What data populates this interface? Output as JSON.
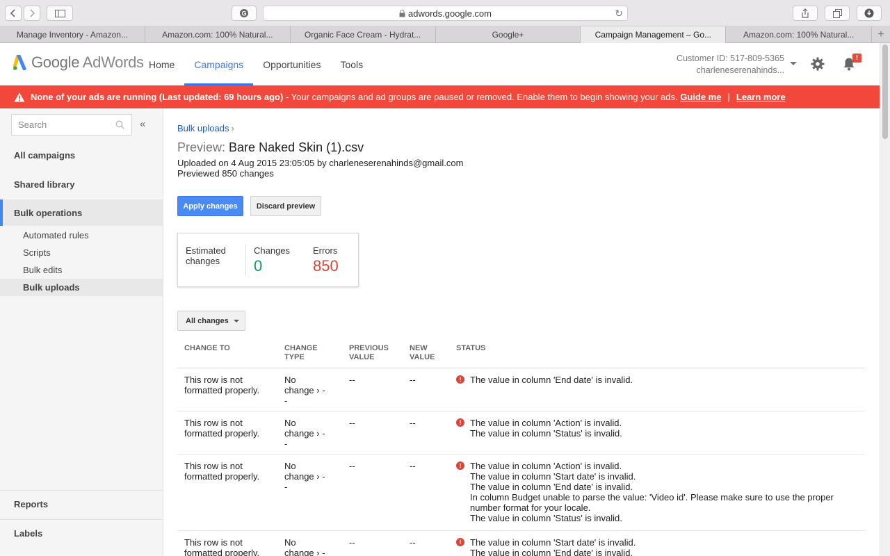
{
  "browser": {
    "url": "adwords.google.com",
    "tabs": [
      {
        "label": "Manage Inventory - Amazon..."
      },
      {
        "label": "Amazon.com: 100% Natural..."
      },
      {
        "label": "Organic Face Cream - Hydrat..."
      },
      {
        "label": "Google+"
      },
      {
        "label": "Campaign Management – Go..."
      },
      {
        "label": "Amazon.com: 100% Natural..."
      }
    ],
    "new_tab": "+"
  },
  "header": {
    "logo_google": "Google",
    "logo_adwords": "AdWords",
    "nav": [
      {
        "label": "Home"
      },
      {
        "label": "Campaigns"
      },
      {
        "label": "Opportunities"
      },
      {
        "label": "Tools"
      }
    ],
    "customer_id": "Customer ID: 517-809-5365",
    "account": "charleneserenahinds...",
    "notification_badge": "!"
  },
  "alert": {
    "bold_text": "None of your ads are running (Last updated: 69 hours ago)",
    "text": " - Your campaigns and ad groups are paused or removed. Enable them to begin showing your ads. ",
    "guide_link": "Guide me",
    "separator": "|",
    "learn_link": "Learn more",
    "color": "#f2483b"
  },
  "sidebar": {
    "search_placeholder": "Search",
    "collapse": "«",
    "items": [
      {
        "label": "All campaigns"
      },
      {
        "label": "Shared library"
      },
      {
        "label": "Bulk operations"
      }
    ],
    "sub_items": [
      {
        "label": "Automated rules"
      },
      {
        "label": "Scripts"
      },
      {
        "label": "Bulk edits"
      },
      {
        "label": "Bulk uploads"
      }
    ],
    "bottom_items": [
      {
        "label": "Reports"
      },
      {
        "label": "Labels"
      }
    ]
  },
  "main": {
    "breadcrumb": "Bulk uploads",
    "breadcrumb_chevron": "›",
    "title_prefix": "Preview:",
    "title": "Bare Naked Skin (1).csv",
    "uploaded": "Uploaded on 4 Aug 2015 23:05:05 by charleneserenahinds@gmail.com",
    "previewed": "Previewed 850 changes",
    "apply_button": "Apply changes",
    "discard_button": "Discard preview",
    "summary": {
      "label": "Estimated changes",
      "changes_label": "Changes",
      "changes_value": "0",
      "errors_label": "Errors",
      "errors_value": "850"
    },
    "filter": "All changes",
    "table": {
      "headers": {
        "change_to": "CHANGE TO",
        "change_type": "CHANGE TYPE",
        "previous_value": "PREVIOUS VALUE",
        "new_value": "NEW VALUE",
        "status": "STATUS"
      },
      "rows": [
        {
          "change_to": "This row is not formatted properly.",
          "change_type_a": "No",
          "change_type_b": "change › -",
          "change_type_c": "-",
          "previous": "--",
          "new": "--",
          "status": [
            "The value in column 'End date' is invalid."
          ]
        },
        {
          "change_to": "This row is not formatted properly.",
          "change_type_a": "No",
          "change_type_b": "change › -",
          "change_type_c": "-",
          "previous": "--",
          "new": "--",
          "status": [
            "The value in column 'Action' is invalid.",
            "The value in column 'Status' is invalid."
          ]
        },
        {
          "change_to": "This row is not formatted properly.",
          "change_type_a": "No",
          "change_type_b": "change › -",
          "change_type_c": "-",
          "previous": "--",
          "new": "--",
          "status": [
            "The value in column 'Action' is invalid.",
            "The value in column 'Start date' is invalid.",
            "The value in column 'End date' is invalid.",
            "In column Budget unable to parse the value: 'Video id'. Please make sure to use the proper number format for your locale.",
            "The value in column 'Status' is invalid."
          ]
        },
        {
          "change_to": "This row is not formatted properly.",
          "change_type_a": "No",
          "change_type_b": "change › -",
          "change_type_c": "-",
          "previous": "--",
          "new": "--",
          "status": [
            "The value in column 'Start date' is invalid.",
            "The value in column 'End date' is invalid."
          ]
        }
      ]
    }
  }
}
